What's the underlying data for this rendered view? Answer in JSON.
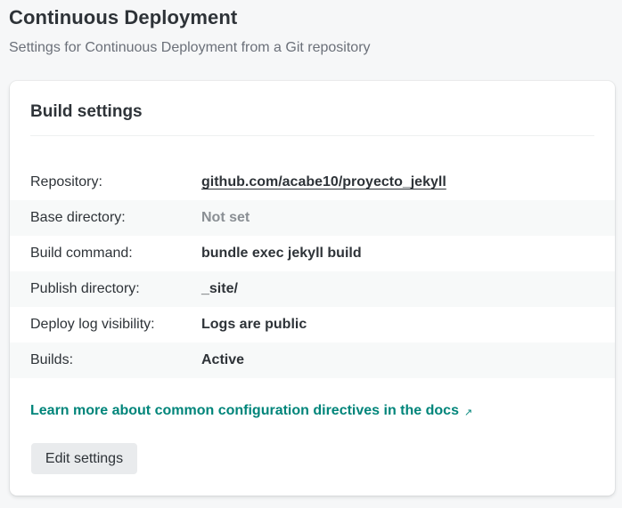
{
  "header": {
    "title": "Continuous Deployment",
    "subtitle": "Settings for Continuous Deployment from a Git repository"
  },
  "card": {
    "title": "Build settings",
    "rows": [
      {
        "label": "Repository:",
        "value": "github.com/acabe10/proyecto_jekyll"
      },
      {
        "label": "Base directory:",
        "value": "Not set"
      },
      {
        "label": "Build command:",
        "value": "bundle exec jekyll build"
      },
      {
        "label": "Publish directory:",
        "value": "_site/"
      },
      {
        "label": "Deploy log visibility:",
        "value": "Logs are public"
      },
      {
        "label": "Builds:",
        "value": "Active"
      }
    ],
    "docs_link": "Learn more about common configuration directives in the docs",
    "docs_link_icon": "external-link-arrow",
    "edit_button": "Edit settings"
  },
  "colors": {
    "accent": "#00857a",
    "muted": "#8a8f94",
    "background": "#f6f7f8"
  }
}
